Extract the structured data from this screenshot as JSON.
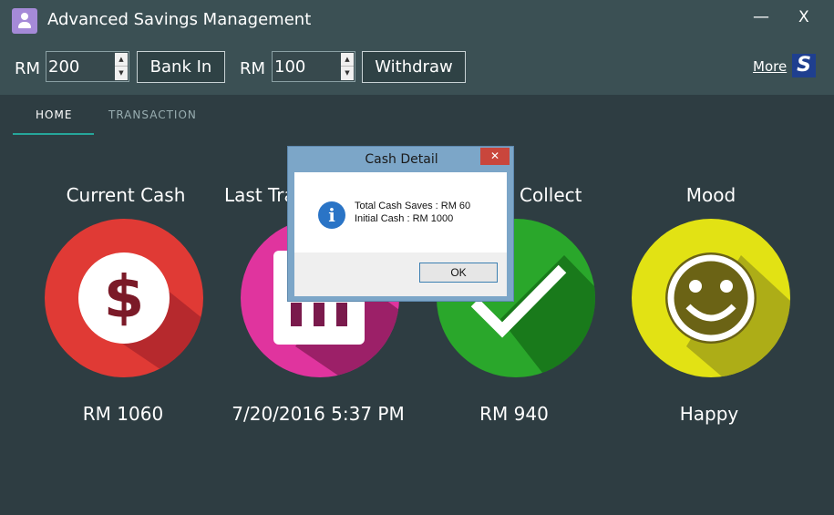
{
  "window": {
    "title": "Advanced Savings Management",
    "minimize_label": "—",
    "close_label": "X"
  },
  "toolbar": {
    "currency_1": "RM",
    "bank_in_amount": "200",
    "bank_in_label": "Bank In",
    "currency_2": "RM",
    "withdraw_amount": "100",
    "withdraw_label": "Withdraw",
    "more_label": "More",
    "logo_letter": "S"
  },
  "tabs": [
    {
      "label": "HOME",
      "active": true
    },
    {
      "label": "TRANSACTION",
      "active": false
    }
  ],
  "cards": [
    {
      "title": "Current Cash",
      "value": "RM 1060",
      "color": "#e03a35",
      "icon": "dollar-icon"
    },
    {
      "title": "Last Tra",
      "value": "7/20/2016 5:37 PM",
      "color": "#e0349e",
      "icon": "calendar-icon"
    },
    {
      "title": "Collect",
      "value": "RM 940",
      "color": "#2aa72b",
      "icon": "check-icon"
    },
    {
      "title": "Mood",
      "value": "Happy",
      "color": "#e2e214",
      "icon": "smiley-icon"
    }
  ],
  "dialog": {
    "title": "Cash Detail",
    "close_label": "✕",
    "line1": "Total Cash Saves : RM 60",
    "line2": "Initial Cash : RM 1000",
    "ok_label": "OK",
    "icon": "info-icon"
  },
  "colors": {
    "background": "#2e3d42",
    "header": "#3b5054",
    "accent": "#26a69a"
  }
}
